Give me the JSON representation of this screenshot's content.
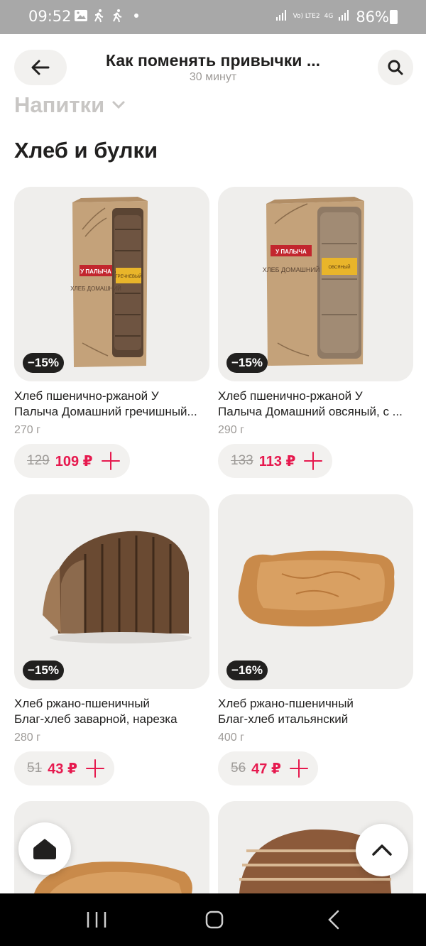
{
  "status_bar": {
    "time": "09:52",
    "network_label": "Vo) LTE2",
    "network_type": "4G",
    "battery": "86%",
    "icons": [
      "gallery-icon",
      "walking-icon",
      "walking-icon",
      "dot-icon",
      "signal-icon",
      "signal-icon",
      "battery-icon"
    ]
  },
  "header": {
    "title": "Как поменять привычки ...",
    "subtitle": "30 минут",
    "back_icon": "arrow-left-icon",
    "search_icon": "search-icon"
  },
  "category_dropdown": {
    "label": "Напитки",
    "icon": "chevron-down-icon"
  },
  "section": {
    "title": "Хлеб и булки"
  },
  "products": [
    {
      "discount": "−15%",
      "name_line1": "Хлеб пшенично-ржаной У",
      "name_line2": "Палыча Домашний гречишный...",
      "weight": "270 г",
      "old_price": "129",
      "new_price": "109 ₽",
      "package_brand": "У ПАЛЫЧА",
      "package_title": "ХЛЕБ ДОМАШНИЙ",
      "sticker": "ГРЕЧНЕВЫЙ"
    },
    {
      "discount": "−15%",
      "name_line1": "Хлеб пшенично-ржаной У",
      "name_line2": "Палыча Домашний овсяный, с ...",
      "weight": "290 г",
      "old_price": "133",
      "new_price": "113 ₽",
      "package_brand": "У ПАЛЫЧА",
      "package_title": "ХЛЕБ ДОМАШНИЙ",
      "sticker": "ОВСЯНЫЙ"
    },
    {
      "discount": "−15%",
      "name_line1": "Хлеб ржано-пшеничный",
      "name_line2": "Благ-хлеб заварной, нарезка",
      "weight": "280 г",
      "old_price": "51",
      "new_price": "43 ₽"
    },
    {
      "discount": "−16%",
      "name_line1": "Хлеб ржано-пшеничный",
      "name_line2": "Благ-хлеб итальянский",
      "weight": "400 г",
      "old_price": "56",
      "new_price": "47 ₽"
    }
  ],
  "floating": {
    "home_icon": "home-icon",
    "scroll_top_icon": "chevron-up-icon"
  },
  "nav_bar": {
    "icons": [
      "recent-apps-icon",
      "home-button-icon",
      "back-icon"
    ]
  },
  "colors": {
    "accent": "#e6194e",
    "card_bg": "#efeeec",
    "pill_bg": "#f2f1ef",
    "text": "#21201f",
    "muted": "#9e9b98"
  }
}
